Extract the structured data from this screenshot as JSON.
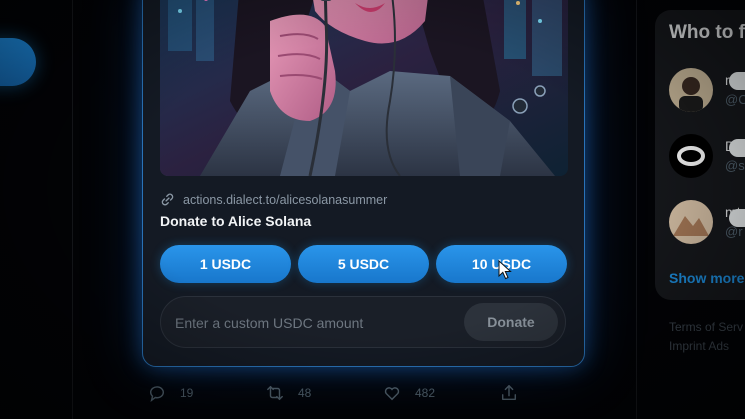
{
  "card": {
    "link": "actions.dialect.to/alicesolanasummer",
    "title": "Donate to Alice Solana",
    "amounts": [
      "1 USDC",
      "5 USDC",
      "10 USDC"
    ],
    "custom_placeholder": "Enter a custom USDC amount",
    "donate_label": "Donate"
  },
  "actions": {
    "reply_count": "19",
    "repost_count": "48",
    "like_count": "482"
  },
  "sidebar": {
    "title": "Who to fo",
    "items": [
      {
        "name": "me",
        "handle": "@C"
      },
      {
        "name": "Dia",
        "handle": "@s"
      },
      {
        "name": "mtn",
        "handle": "@r"
      }
    ],
    "show_more": "Show more",
    "footer": [
      "Terms of Serv",
      "Imprint   Ads"
    ]
  },
  "colors": {
    "accent": "#1d9bf0",
    "card_border": "#2a73b8",
    "background": "#000000"
  },
  "icons": [
    "link-icon",
    "reply-icon",
    "repost-icon",
    "like-icon",
    "share-icon",
    "cursor-icon"
  ]
}
